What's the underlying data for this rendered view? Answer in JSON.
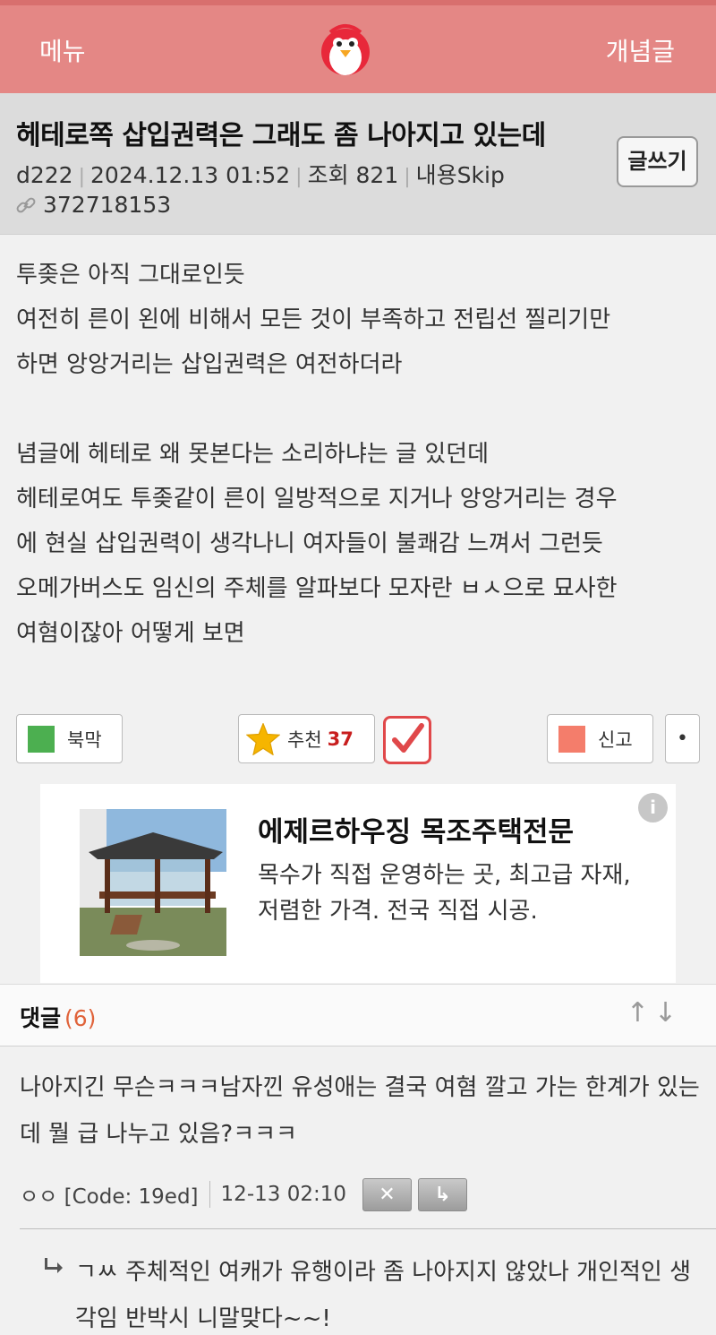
{
  "topbar": {
    "menu_label": "메뉴",
    "concept_label": "개념글"
  },
  "post": {
    "title": "헤테로쪽 삽입권력은 그래도 좀 나아지고 있는데",
    "author": "d222",
    "datetime": "2024.12.13 01:52",
    "views": "조회 821",
    "skip": "내용Skip",
    "post_id": "372718153",
    "write_label": "글쓰기",
    "body_lines": [
      "투좆은 아직 그대로인듯",
      "여전히 른이 왼에 비해서 모든 것이 부족하고 전립선 찔리기만",
      "하면 앙앙거리는 삽입권력은 여전하더라",
      "",
      "념글에 헤테로 왜 못본다는 소리하냐는 글 있던데",
      "헤테로여도 투좆같이 른이 일방적으로 지거나 앙앙거리는 경우",
      "에 현실 삽입권력이 생각나니 여자들이 불쾌감 느껴서 그런듯",
      "오메가버스도 임신의 주체를 알파보다 모자란 ㅂㅅ으로 묘사한",
      "여혐이잖아 어떻게 보면"
    ]
  },
  "actions": {
    "bookmark_label": "북막",
    "recommend_label": "추천",
    "recommend_count": "37",
    "report_label": "신고",
    "more_label": "•"
  },
  "ad": {
    "title": "에제르하우징 목조주택전문",
    "desc": "목수가 직접 운영하는 곳, 최고급 자재, 저렴한 가격. 전국 직접 시공.",
    "info_label": "i"
  },
  "comments": {
    "header_label": "댓글",
    "count": "(6)",
    "sort_arrows": "↑↓",
    "first": {
      "text": "나아지긴 무슨ㅋㅋㅋ남자낀 유성애는 결국 여혐 깔고 가는 한계가 있는데 뭘 급 나누고 있음?ㅋㅋㅋ",
      "author": "ㅇㅇ [Code: 19ed]",
      "time": "12-13 02:10",
      "delete_glyph": "✕",
      "reply_glyph": "↳"
    },
    "reply": {
      "text": "ㄱㅆ 주체적인 여캐가 유행이라 좀 나아지지 않았나 개인적인 생각임 반박시 니말맞다~~!"
    }
  },
  "colors": {
    "topbar": "#e48785",
    "bookmark": "#4caf50",
    "report": "#f47d6b",
    "accent_red": "#e0484a",
    "comment_count": "#e0633a"
  },
  "icons": [
    "penguin-logo",
    "link-icon",
    "star-icon",
    "check-icon",
    "info-icon",
    "reply-arrow-icon",
    "arrow-up-icon",
    "arrow-down-icon"
  ]
}
